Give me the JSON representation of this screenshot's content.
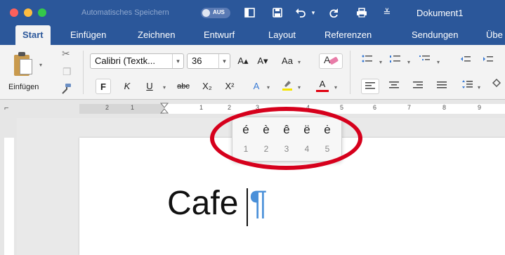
{
  "titlebar": {
    "autosave_label": "Automatisches Speichern",
    "autosave_toggle": "AUS",
    "document_title": "Dokument1",
    "icons": [
      "sidebar-icon",
      "save-icon",
      "undo-icon",
      "redo-icon",
      "print-icon",
      "customize-icon"
    ]
  },
  "tabs": [
    "Start",
    "Einfügen",
    "Zeichnen",
    "Entwurf",
    "Layout",
    "Referenzen",
    "Sendungen",
    "Übe"
  ],
  "ribbon": {
    "paste_label": "Einfügen",
    "font_name": "Calibri (Textk...",
    "font_size": "36",
    "grow_font": "A▴",
    "shrink_font": "A▾",
    "change_case": "Aa",
    "bold": "F",
    "italic": "K",
    "underline": "U",
    "strikethrough": "abc",
    "subscript": "X₂",
    "superscript": "X²",
    "text_effects": "A",
    "font_color": "A"
  },
  "ruler": {
    "numbers": [
      "2",
      "1",
      "1",
      "2",
      "3",
      "4",
      "5",
      "6",
      "7",
      "8",
      "9"
    ]
  },
  "document": {
    "text": "Cafe",
    "pilcrow": "¶"
  },
  "accent_popup": {
    "options": [
      {
        "char": "é",
        "key": "1"
      },
      {
        "char": "è",
        "key": "2"
      },
      {
        "char": "ê",
        "key": "3"
      },
      {
        "char": "ë",
        "key": "4"
      },
      {
        "char": "ė",
        "key": "5"
      }
    ]
  },
  "colors": {
    "brand": "#2b579a",
    "annotation": "#d6001c",
    "pilcrow": "#4a90d9",
    "highlight": "#f5e400",
    "font_color_bar": "#e0000f"
  }
}
